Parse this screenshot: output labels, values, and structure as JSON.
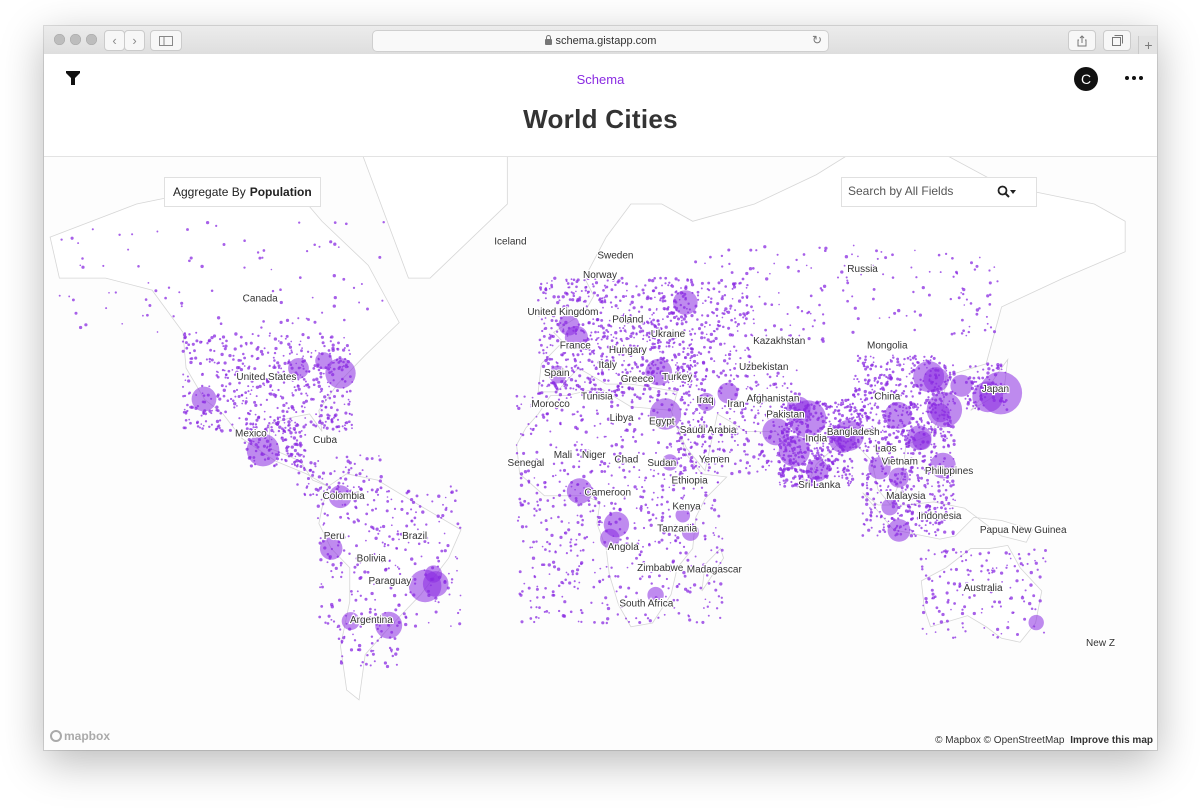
{
  "browser": {
    "url": "schema.gistapp.com"
  },
  "app": {
    "brand": "Schema",
    "title": "World Cities",
    "avatar_initial": "C"
  },
  "controls": {
    "aggregate_prefix": "Aggregate By",
    "aggregate_field": "Population",
    "search_placeholder": "Search by All Fields"
  },
  "map": {
    "point_color": "#8a2be2",
    "labels": [
      {
        "name": "Iceland",
        "lon": -19,
        "lat": 65
      },
      {
        "name": "Sweden",
        "lon": 15,
        "lat": 63
      },
      {
        "name": "Norway",
        "lon": 10,
        "lat": 60
      },
      {
        "name": "Russia",
        "lon": 95,
        "lat": 61
      },
      {
        "name": "Canada",
        "lon": -100,
        "lat": 56
      },
      {
        "name": "United Kingdom",
        "lon": -2,
        "lat": 53.5
      },
      {
        "name": "Poland",
        "lon": 19,
        "lat": 52
      },
      {
        "name": "Ukraine",
        "lon": 32,
        "lat": 49
      },
      {
        "name": "France",
        "lon": 2,
        "lat": 46.5
      },
      {
        "name": "Hungary",
        "lon": 19,
        "lat": 45.5
      },
      {
        "name": "Kazakhstan",
        "lon": 68,
        "lat": 47.5
      },
      {
        "name": "Mongolia",
        "lon": 103,
        "lat": 46.5
      },
      {
        "name": "Italy",
        "lon": 12.5,
        "lat": 42
      },
      {
        "name": "Uzbekistan",
        "lon": 63,
        "lat": 41.5
      },
      {
        "name": "Spain",
        "lon": -4,
        "lat": 40
      },
      {
        "name": "Greece",
        "lon": 22,
        "lat": 38.5
      },
      {
        "name": "Turkey",
        "lon": 35,
        "lat": 39
      },
      {
        "name": "United States",
        "lon": -98,
        "lat": 39
      },
      {
        "name": "China",
        "lon": 103,
        "lat": 34
      },
      {
        "name": "Japan",
        "lon": 138,
        "lat": 36
      },
      {
        "name": "Tunisia",
        "lon": 9,
        "lat": 34
      },
      {
        "name": "Iraq",
        "lon": 44,
        "lat": 33
      },
      {
        "name": "Afghanistan",
        "lon": 66,
        "lat": 33.5
      },
      {
        "name": "Iran",
        "lon": 54,
        "lat": 32
      },
      {
        "name": "Morocco",
        "lon": -6,
        "lat": 32
      },
      {
        "name": "Pakistan",
        "lon": 70,
        "lat": 29
      },
      {
        "name": "Libya",
        "lon": 17,
        "lat": 28
      },
      {
        "name": "Egypt",
        "lon": 30,
        "lat": 27
      },
      {
        "name": "Saudi Arabia",
        "lon": 45,
        "lat": 24.5
      },
      {
        "name": "Bangladesh",
        "lon": 92,
        "lat": 24
      },
      {
        "name": "India",
        "lon": 80,
        "lat": 22
      },
      {
        "name": "Mexico",
        "lon": -103,
        "lat": 23.5
      },
      {
        "name": "Cuba",
        "lon": -79,
        "lat": 21.5
      },
      {
        "name": "Laos",
        "lon": 102.5,
        "lat": 19
      },
      {
        "name": "Mali",
        "lon": -2,
        "lat": 17
      },
      {
        "name": "Niger",
        "lon": 8,
        "lat": 17
      },
      {
        "name": "Chad",
        "lon": 18.5,
        "lat": 15.5
      },
      {
        "name": "Sudan",
        "lon": 30,
        "lat": 14.5
      },
      {
        "name": "Yemen",
        "lon": 47,
        "lat": 15.5
      },
      {
        "name": "Vietnam",
        "lon": 107,
        "lat": 15
      },
      {
        "name": "Senegal",
        "lon": -14,
        "lat": 14.5
      },
      {
        "name": "Philippines",
        "lon": 123,
        "lat": 12
      },
      {
        "name": "Ethiopia",
        "lon": 39,
        "lat": 9
      },
      {
        "name": "Sri Lanka",
        "lon": 81,
        "lat": 7.5
      },
      {
        "name": "Malaysia",
        "lon": 109,
        "lat": 4
      },
      {
        "name": "Colombia",
        "lon": -73,
        "lat": 4
      },
      {
        "name": "Cameroon",
        "lon": 12.5,
        "lat": 5
      },
      {
        "name": "Kenya",
        "lon": 38,
        "lat": 0.5
      },
      {
        "name": "Indonesia",
        "lon": 120,
        "lat": -2.5
      },
      {
        "name": "Tanzania",
        "lon": 35,
        "lat": -6.5
      },
      {
        "name": "Papua New Guinea",
        "lon": 147,
        "lat": -7
      },
      {
        "name": "Brazil",
        "lon": -50,
        "lat": -9
      },
      {
        "name": "Peru",
        "lon": -76,
        "lat": -9
      },
      {
        "name": "Angola",
        "lon": 17.5,
        "lat": -12.5
      },
      {
        "name": "Bolivia",
        "lon": -64,
        "lat": -16
      },
      {
        "name": "Zimbabwe",
        "lon": 29.5,
        "lat": -19
      },
      {
        "name": "Madagascar",
        "lon": 47,
        "lat": -19.5
      },
      {
        "name": "Paraguay",
        "lon": -58,
        "lat": -23
      },
      {
        "name": "Australia",
        "lon": 134,
        "lat": -25
      },
      {
        "name": "South Africa",
        "lon": 25,
        "lat": -29.5
      },
      {
        "name": "Argentina",
        "lon": -64,
        "lat": -34
      },
      {
        "name": "New Z",
        "lon": 172,
        "lat": -40
      }
    ],
    "big_circles": [
      {
        "lon": 139.7,
        "lat": 35.7,
        "pop": 37400000
      },
      {
        "lon": 77.2,
        "lat": 28.6,
        "pop": 28500000
      },
      {
        "lon": 121.5,
        "lat": 31.2,
        "pop": 25600000
      },
      {
        "lon": -46.6,
        "lat": -23.5,
        "pop": 21650000
      },
      {
        "lon": -99.1,
        "lat": 19.4,
        "pop": 21580000
      },
      {
        "lon": 31.2,
        "lat": 30.0,
        "pop": 20080000
      },
      {
        "lon": 72.9,
        "lat": 19.1,
        "pop": 19980000
      },
      {
        "lon": 116.4,
        "lat": 39.9,
        "pop": 19620000
      },
      {
        "lon": 90.4,
        "lat": 23.8,
        "pop": 19580000
      },
      {
        "lon": 135.5,
        "lat": 34.7,
        "pop": 19280000
      },
      {
        "lon": -74.0,
        "lat": 40.7,
        "pop": 18820000
      },
      {
        "lon": 67.0,
        "lat": 24.9,
        "pop": 15400000
      },
      {
        "lon": -58.4,
        "lat": -34.6,
        "pop": 14970000
      },
      {
        "lon": 88.4,
        "lat": 22.6,
        "pop": 14680000
      },
      {
        "lon": 29.0,
        "lat": 41.0,
        "pop": 14750000
      },
      {
        "lon": 106.5,
        "lat": 29.6,
        "pop": 14840000
      },
      {
        "lon": 3.4,
        "lat": 6.5,
        "pop": 13460000
      },
      {
        "lon": 121.0,
        "lat": 14.6,
        "pop": 13480000
      },
      {
        "lon": 113.3,
        "lat": 23.1,
        "pop": 12640000
      },
      {
        "lon": -43.2,
        "lat": -22.9,
        "pop": 13290000
      },
      {
        "lon": 118.8,
        "lat": 39.1,
        "pop": 13210000
      },
      {
        "lon": 37.6,
        "lat": 55.8,
        "pop": 12410000
      },
      {
        "lon": 2.35,
        "lat": 48.9,
        "pop": 10900000
      },
      {
        "lon": 80.3,
        "lat": 13.1,
        "pop": 10460000
      },
      {
        "lon": -77.0,
        "lat": -12.0,
        "pop": 10390000
      },
      {
        "lon": -118.2,
        "lat": 34.1,
        "pop": 12460000
      },
      {
        "lon": -0.1,
        "lat": 51.5,
        "pop": 9050000
      },
      {
        "lon": 106.8,
        "lat": -6.2,
        "pop": 10520000
      },
      {
        "lon": 100.5,
        "lat": 13.8,
        "pop": 10160000
      },
      {
        "lon": 126.98,
        "lat": 37.6,
        "pop": 9960000
      },
      {
        "lon": 51.4,
        "lat": 35.7,
        "pop": 8900000
      },
      {
        "lon": 74.3,
        "lat": 31.5,
        "pop": 11740000
      },
      {
        "lon": 103.8,
        "lat": 1.35,
        "pop": 5790000
      },
      {
        "lon": -87.6,
        "lat": 41.9,
        "pop": 8860000
      },
      {
        "lon": -74.1,
        "lat": 4.7,
        "pop": 10570000
      },
      {
        "lon": 15.3,
        "lat": -4.3,
        "pop": 13170000
      },
      {
        "lon": 44.4,
        "lat": 33.3,
        "pop": 6800000
      },
      {
        "lon": 120.2,
        "lat": 30.3,
        "pop": 7240000
      },
      {
        "lon": 114.2,
        "lat": 22.3,
        "pop": 7430000
      },
      {
        "lon": 106.7,
        "lat": 10.8,
        "pop": 8150000
      },
      {
        "lon": -3.7,
        "lat": 40.4,
        "pop": 6500000
      },
      {
        "lon": 32.6,
        "lat": 15.6,
        "pop": 5530000
      },
      {
        "lon": 36.8,
        "lat": -1.3,
        "pop": 4390000
      },
      {
        "lon": 28.0,
        "lat": -26.2,
        "pop": 5490000
      },
      {
        "lon": -79.4,
        "lat": 43.7,
        "pop": 6080000
      },
      {
        "lon": 151.2,
        "lat": -33.9,
        "pop": 4790000
      },
      {
        "lon": -70.7,
        "lat": -33.5,
        "pop": 6680000
      },
      {
        "lon": 39.3,
        "lat": -6.8,
        "pop": 6050000
      },
      {
        "lon": 13.2,
        "lat": -8.8,
        "pop": 7780000
      },
      {
        "lon": -43.9,
        "lat": -19.9,
        "pop": 5970000
      }
    ]
  },
  "footer": {
    "mapbox_logo": "mapbox",
    "attribution": "© Mapbox © OpenStreetMap",
    "improve_link": "Improve this map"
  }
}
